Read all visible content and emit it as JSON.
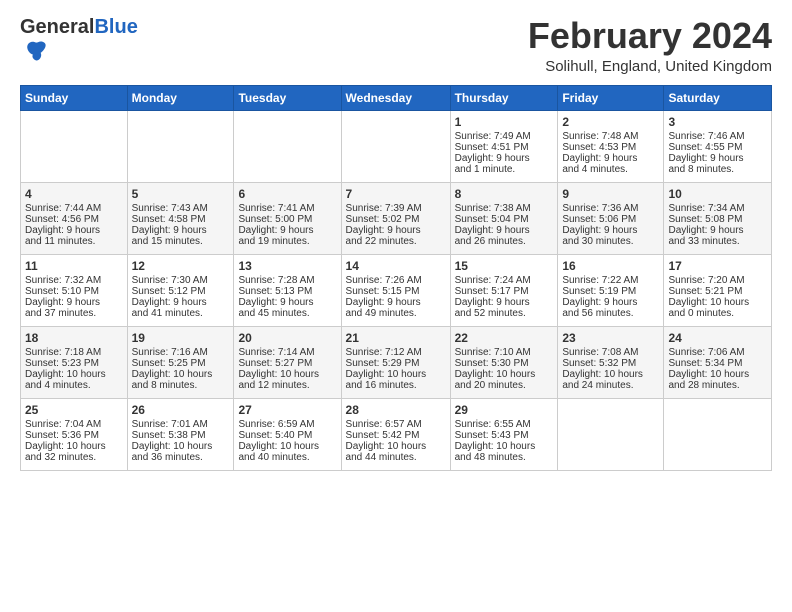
{
  "header": {
    "logo_general": "General",
    "logo_blue": "Blue",
    "month_title": "February 2024",
    "location": "Solihull, England, United Kingdom"
  },
  "days_of_week": [
    "Sunday",
    "Monday",
    "Tuesday",
    "Wednesday",
    "Thursday",
    "Friday",
    "Saturday"
  ],
  "weeks": [
    [
      {
        "day": "",
        "content": ""
      },
      {
        "day": "",
        "content": ""
      },
      {
        "day": "",
        "content": ""
      },
      {
        "day": "",
        "content": ""
      },
      {
        "day": "1",
        "content": "Sunrise: 7:49 AM\nSunset: 4:51 PM\nDaylight: 9 hours\nand 1 minute."
      },
      {
        "day": "2",
        "content": "Sunrise: 7:48 AM\nSunset: 4:53 PM\nDaylight: 9 hours\nand 4 minutes."
      },
      {
        "day": "3",
        "content": "Sunrise: 7:46 AM\nSunset: 4:55 PM\nDaylight: 9 hours\nand 8 minutes."
      }
    ],
    [
      {
        "day": "4",
        "content": "Sunrise: 7:44 AM\nSunset: 4:56 PM\nDaylight: 9 hours\nand 11 minutes."
      },
      {
        "day": "5",
        "content": "Sunrise: 7:43 AM\nSunset: 4:58 PM\nDaylight: 9 hours\nand 15 minutes."
      },
      {
        "day": "6",
        "content": "Sunrise: 7:41 AM\nSunset: 5:00 PM\nDaylight: 9 hours\nand 19 minutes."
      },
      {
        "day": "7",
        "content": "Sunrise: 7:39 AM\nSunset: 5:02 PM\nDaylight: 9 hours\nand 22 minutes."
      },
      {
        "day": "8",
        "content": "Sunrise: 7:38 AM\nSunset: 5:04 PM\nDaylight: 9 hours\nand 26 minutes."
      },
      {
        "day": "9",
        "content": "Sunrise: 7:36 AM\nSunset: 5:06 PM\nDaylight: 9 hours\nand 30 minutes."
      },
      {
        "day": "10",
        "content": "Sunrise: 7:34 AM\nSunset: 5:08 PM\nDaylight: 9 hours\nand 33 minutes."
      }
    ],
    [
      {
        "day": "11",
        "content": "Sunrise: 7:32 AM\nSunset: 5:10 PM\nDaylight: 9 hours\nand 37 minutes."
      },
      {
        "day": "12",
        "content": "Sunrise: 7:30 AM\nSunset: 5:12 PM\nDaylight: 9 hours\nand 41 minutes."
      },
      {
        "day": "13",
        "content": "Sunrise: 7:28 AM\nSunset: 5:13 PM\nDaylight: 9 hours\nand 45 minutes."
      },
      {
        "day": "14",
        "content": "Sunrise: 7:26 AM\nSunset: 5:15 PM\nDaylight: 9 hours\nand 49 minutes."
      },
      {
        "day": "15",
        "content": "Sunrise: 7:24 AM\nSunset: 5:17 PM\nDaylight: 9 hours\nand 52 minutes."
      },
      {
        "day": "16",
        "content": "Sunrise: 7:22 AM\nSunset: 5:19 PM\nDaylight: 9 hours\nand 56 minutes."
      },
      {
        "day": "17",
        "content": "Sunrise: 7:20 AM\nSunset: 5:21 PM\nDaylight: 10 hours\nand 0 minutes."
      }
    ],
    [
      {
        "day": "18",
        "content": "Sunrise: 7:18 AM\nSunset: 5:23 PM\nDaylight: 10 hours\nand 4 minutes."
      },
      {
        "day": "19",
        "content": "Sunrise: 7:16 AM\nSunset: 5:25 PM\nDaylight: 10 hours\nand 8 minutes."
      },
      {
        "day": "20",
        "content": "Sunrise: 7:14 AM\nSunset: 5:27 PM\nDaylight: 10 hours\nand 12 minutes."
      },
      {
        "day": "21",
        "content": "Sunrise: 7:12 AM\nSunset: 5:29 PM\nDaylight: 10 hours\nand 16 minutes."
      },
      {
        "day": "22",
        "content": "Sunrise: 7:10 AM\nSunset: 5:30 PM\nDaylight: 10 hours\nand 20 minutes."
      },
      {
        "day": "23",
        "content": "Sunrise: 7:08 AM\nSunset: 5:32 PM\nDaylight: 10 hours\nand 24 minutes."
      },
      {
        "day": "24",
        "content": "Sunrise: 7:06 AM\nSunset: 5:34 PM\nDaylight: 10 hours\nand 28 minutes."
      }
    ],
    [
      {
        "day": "25",
        "content": "Sunrise: 7:04 AM\nSunset: 5:36 PM\nDaylight: 10 hours\nand 32 minutes."
      },
      {
        "day": "26",
        "content": "Sunrise: 7:01 AM\nSunset: 5:38 PM\nDaylight: 10 hours\nand 36 minutes."
      },
      {
        "day": "27",
        "content": "Sunrise: 6:59 AM\nSunset: 5:40 PM\nDaylight: 10 hours\nand 40 minutes."
      },
      {
        "day": "28",
        "content": "Sunrise: 6:57 AM\nSunset: 5:42 PM\nDaylight: 10 hours\nand 44 minutes."
      },
      {
        "day": "29",
        "content": "Sunrise: 6:55 AM\nSunset: 5:43 PM\nDaylight: 10 hours\nand 48 minutes."
      },
      {
        "day": "",
        "content": ""
      },
      {
        "day": "",
        "content": ""
      }
    ]
  ]
}
